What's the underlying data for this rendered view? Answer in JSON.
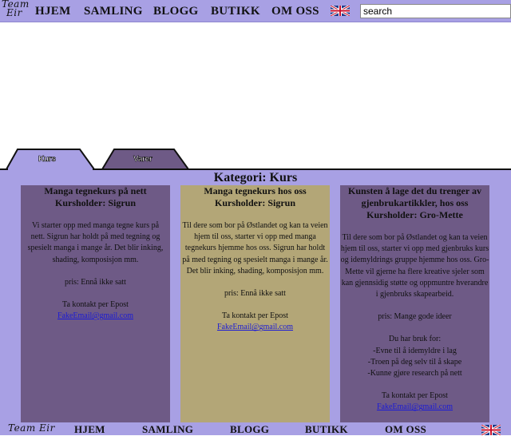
{
  "header": {
    "logo_line1": "Team",
    "logo_line2": "Eir",
    "nav": [
      "HJEM",
      "SAMLING",
      "BLOGG",
      "BUTIKK",
      "OM OSS"
    ],
    "search_value": "search"
  },
  "tabs": [
    {
      "label": "Kurs"
    },
    {
      "label": "Varer"
    }
  ],
  "category_title": "Kategori: Kurs",
  "cards": [
    {
      "title": "Manga tegnekurs på nett Kursholder: Sigrun",
      "body": "Vi starter opp med manga tegne kurs på nett. Sigrun har holdt på med tegning og spesielt manga i mange år. Det blir inking, shading, komposisjon mm.",
      "price": "pris: Ennå ikke satt",
      "contact": "Ta kontakt per Epost",
      "email": "FakeEmail@gmail.com",
      "color": "#6e5a86"
    },
    {
      "title": "Manga tegnekurs hos oss Kursholder: Sigrun",
      "body": "Til dere som bor på Østlandet og kan ta veien hjem til oss, starter vi opp med manga tegnekurs hjemme hos oss. Sigrun har holdt på med tegning og spesielt manga i mange år. Det blir inking, shading, komposisjon mm.",
      "price": "pris: Ennå ikke satt",
      "contact": "Ta kontakt per Epost",
      "email": "FakeEmail@gmail.com",
      "color": "#b3a677"
    },
    {
      "title": "Kunsten å lage det du trenger av gjenbrukartikkler, hos oss Kursholder: Gro-Mette",
      "body": "Til dere som bor på Østlandet og kan ta veien hjem til oss, starter vi opp med gjenbruks kurs og idemyldrings gruppe hjemme hos oss. Gro-Mette vil gjerne ha flere kreative sjeler som kan gjennsidig støtte og oppmuntre hverandre i gjenbruks skapearbeid.",
      "price": "pris: Mange gode ideer",
      "extra_title": "Du har bruk for:",
      "extra_items": [
        "-Evne til å idemyldre i lag",
        "-Troen på deg selv til å skape",
        "-Kunne gjøre research på nett"
      ],
      "contact": "Ta kontakt per Epost",
      "email": "FakeEmail@gmail.com",
      "color": "#6e5a86"
    }
  ],
  "footer": {
    "logo_text": "Team Eir",
    "nav": [
      "HJEM",
      "SAMLING",
      "BLOGG",
      "BUTIKK",
      "OM OSS"
    ]
  },
  "colors": {
    "bar": "#a8a0e4",
    "card_purple": "#6e5a86",
    "card_khaki": "#b3a677",
    "link": "#1a1ad6"
  },
  "icons": {
    "flag": "uk-flag-icon"
  }
}
